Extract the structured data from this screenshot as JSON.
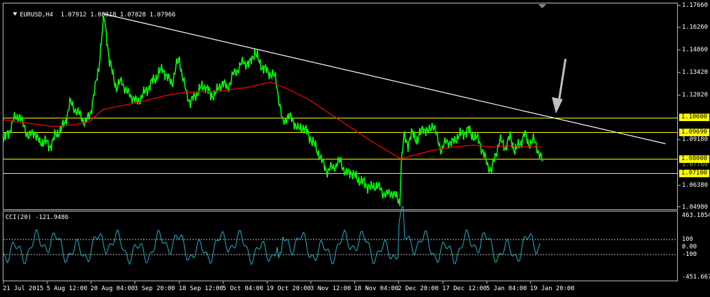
{
  "main_panel": {
    "symbol": "EURUSD,H4",
    "ohlc": "1.07912 1.08018 1.07828 1.07966",
    "price_axis": [
      "1.17660",
      "1.16260",
      "1.14860",
      "1.13420",
      "1.12020",
      "1.09180",
      "1.06380",
      "1.04980"
    ],
    "levels": [
      {
        "label": "1.10600",
        "value": 1.106
      },
      {
        "label": "1.09690",
        "value": 1.0969
      },
      {
        "label": "1.08000",
        "value": 1.08
      },
      {
        "label": "1.07100",
        "value": 1.071
      }
    ],
    "hidden_label": "1.07760"
  },
  "cci_panel": {
    "title": "CCI(20) -121.9486",
    "axis": [
      "463.1854",
      "100",
      "0.00",
      "-100",
      "-451.6679"
    ]
  },
  "time_axis": [
    "21 Jul 2015",
    "5 Aug 12:00",
    "20 Aug 04:00",
    "3 Sep 20:00",
    "18 Sep 12:00",
    "5 Oct 04:00",
    "19 Oct 20:00",
    "3 Nov 12:00",
    "18 Nov 04:00",
    "2 Dec 20:00",
    "17 Dec 12:00",
    "5 Jan 04:00",
    "19 Jan 20:00"
  ],
  "colors": {
    "price": "#00ff00",
    "ma": "#ff0000",
    "level": "#ffff00",
    "trendline": "#ffffff",
    "cci": "#20b2c8",
    "arrow": "#c0c0c0"
  }
}
